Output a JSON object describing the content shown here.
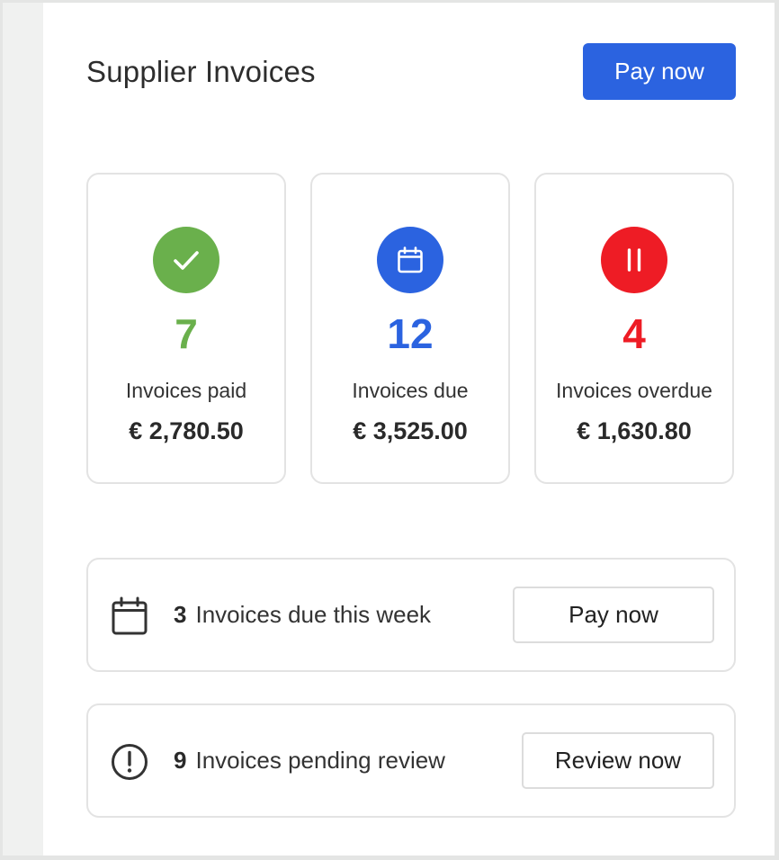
{
  "header": {
    "title": "Supplier Invoices",
    "pay_now_label": "Pay now"
  },
  "stats": [
    {
      "icon": "checkmark-icon",
      "color": "#6ab04c",
      "count": "7",
      "label": "Invoices paid",
      "amount": "€ 2,780.50"
    },
    {
      "icon": "calendar-icon",
      "color": "#2b63e0",
      "count": "12",
      "label": "Invoices due",
      "amount": "€ 3,525.00"
    },
    {
      "icon": "pause-icon",
      "color": "#ee1c25",
      "count": "4",
      "label": "Invoices overdue",
      "amount": "€ 1,630.80"
    }
  ],
  "tasks": [
    {
      "icon": "calendar-icon",
      "count": "3",
      "text": "Invoices due this week",
      "button": "Pay now"
    },
    {
      "icon": "alert-circle-icon",
      "count": "9",
      "text": "Invoices pending review",
      "button": "Review now"
    }
  ],
  "colors": {
    "primary": "#2b63e0",
    "paid": "#6ab04c",
    "due": "#2b63e0",
    "overdue": "#ee1c25"
  }
}
